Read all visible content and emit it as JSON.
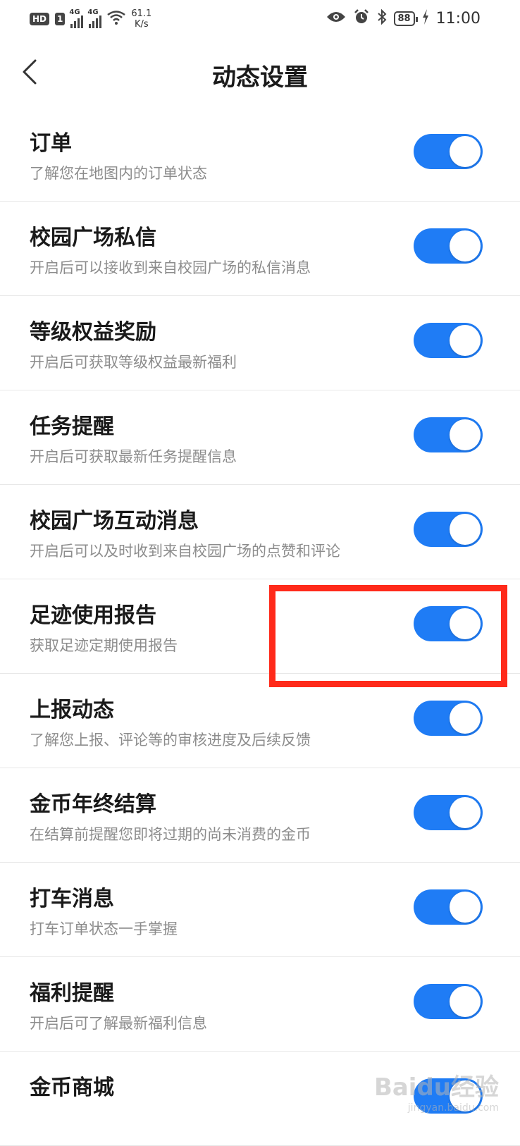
{
  "status_bar": {
    "hd": "HD",
    "sim": "1",
    "network_1": "4G",
    "network_2": "4G",
    "net_speed_value": "61.1",
    "net_speed_unit": "K/s",
    "battery": "88",
    "time": "11:00"
  },
  "header": {
    "title": "动态设置",
    "back_icon": "chevron-left-icon"
  },
  "settings": [
    {
      "title": "订单",
      "desc": "了解您在地图内的订单状态",
      "enabled": true
    },
    {
      "title": "校园广场私信",
      "desc": "开启后可以接收到来自校园广场的私信消息",
      "enabled": true
    },
    {
      "title": "等级权益奖励",
      "desc": "开启后可获取等级权益最新福利",
      "enabled": true
    },
    {
      "title": "任务提醒",
      "desc": "开启后可获取最新任务提醒信息",
      "enabled": true
    },
    {
      "title": "校园广场互动消息",
      "desc": "开启后可以及时收到来自校园广场的点赞和评论",
      "enabled": true
    },
    {
      "title": "足迹使用报告",
      "desc": "获取足迹定期使用报告",
      "enabled": true
    },
    {
      "title": "上报动态",
      "desc": "了解您上报、评论等的审核进度及后续反馈",
      "enabled": true
    },
    {
      "title": "金币年终结算",
      "desc": "在结算前提醒您即将过期的尚未消费的金币",
      "enabled": true
    },
    {
      "title": "打车消息",
      "desc": "打车订单状态一手掌握",
      "enabled": true
    },
    {
      "title": "福利提醒",
      "desc": "开启后可了解最新福利信息",
      "enabled": true
    },
    {
      "title": "金币商城",
      "desc": "",
      "enabled": true
    }
  ],
  "colors": {
    "toggle_on": "#1f7cf5",
    "highlight": "#ff2a1a"
  },
  "watermark": {
    "brand": "Baidu经验",
    "url": "jingyan.baidu.com"
  }
}
